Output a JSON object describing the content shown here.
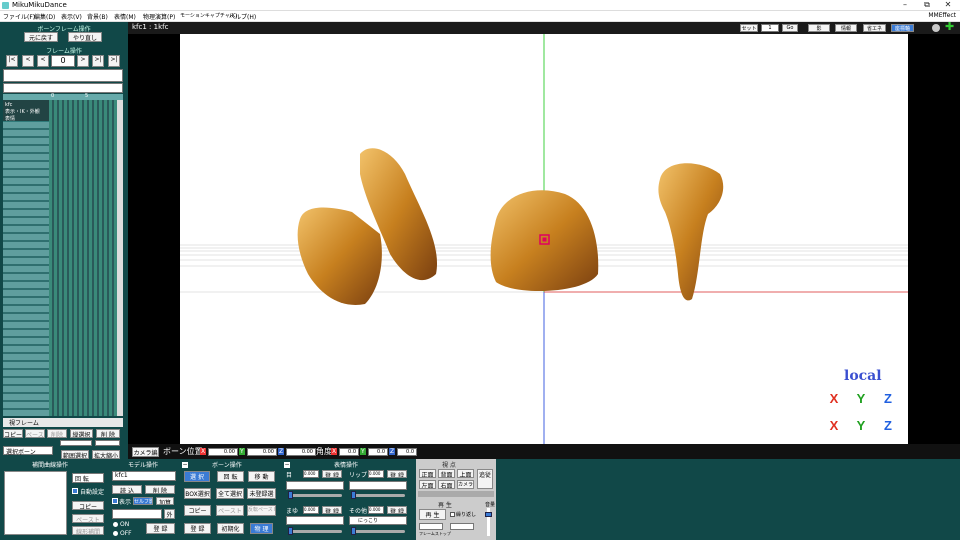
{
  "window": {
    "title": "MikuMikuDance",
    "min_glyph": "–",
    "max_glyph": "⧉",
    "close_glyph": "✕"
  },
  "menu": [
    "ファイル(F)",
    "編集(D)",
    "表示(V)",
    "背景(B)",
    "表情(M)",
    "物理演算(P)",
    "モーションキャプチャ(K)",
    "ヘルプ(H)"
  ],
  "mme": "MMEffect",
  "left": {
    "bone_frame_title": "ボーンフレーム操作",
    "undo": "元に戻す",
    "redo": "やり直し",
    "frame_title": "フレーム操作",
    "nav": [
      "|<",
      "<",
      "<"
    ],
    "frame_value": "0",
    "nav2": [
      ">",
      ">|",
      ">|"
    ],
    "tl_cols": [
      "0",
      "5"
    ],
    "tl_labels": [
      "kfc",
      "表示・IK・外観",
      "表情"
    ],
    "view_frame": "視フレーム",
    "row1": [
      "コピー",
      "ペースト",
      "削除",
      "縦選択",
      "削 除"
    ],
    "sel_bone": "選択ボーン",
    "range_sel": "範囲選択",
    "expand": "拡大縮小"
  },
  "viewport": {
    "model_label": "kfc1 : 1kfc",
    "set_label": "セット",
    "set_value": "1",
    "go": "Go",
    "shadow": "影",
    "info": "情報",
    "eco": "省エネ",
    "axis": "座標軸",
    "local": "local",
    "axes_colors": {
      "x": "#e03020",
      "y": "#20a020",
      "z": "#2060e0"
    }
  },
  "posbar": {
    "camera_tab": "カメラ編",
    "bone_pos": "ボーン位置",
    "x": "0.00",
    "y": "0.00",
    "z": "0.00",
    "angle": "角度",
    "ax": "0.0",
    "ay": "0.0",
    "az": "0.0"
  },
  "bottom": {
    "interp_title": "補間曲線操作",
    "rotate": "回 転",
    "auto_set": "自動設定",
    "copy": "コピー",
    "paste": "ペースト",
    "linear": "線形補間",
    "model_title": "モデル操作",
    "model_select": "kfc1",
    "load": "読 込",
    "delete": "削 除",
    "show": "表示",
    "shadow": "セルフ影",
    "add": "加算",
    "outer": "外",
    "on": "ON",
    "off": "OFF",
    "register": "登 録",
    "bone_title": "ボーン操作",
    "select": "選 択",
    "rot": "回 転",
    "move": "移 動",
    "box_select": "BOX選択",
    "select_all": "全て選択",
    "unreg_select": "未登録選",
    "copy2": "コピー",
    "paste2": "ペースト",
    "paste_rev": "反転ペースト",
    "register2": "登 録",
    "reset": "初期化",
    "physics": "物 理",
    "face_title": "表情操作",
    "eye": "目",
    "lip": "リップ",
    "brow": "まゆ",
    "other": "その他",
    "face_val": "0.000",
    "face_other_sel": "にっこり",
    "view_title": "視 点",
    "front": "正面",
    "back": "背面",
    "top": "上面",
    "left": "左面",
    "right": "右面",
    "camera": "カメラ",
    "follow": "追従",
    "play_title": "再 生",
    "play": "再 生",
    "repeat": "繰り返し",
    "frame_stop": "フレームストップ",
    "volume": "音量"
  }
}
